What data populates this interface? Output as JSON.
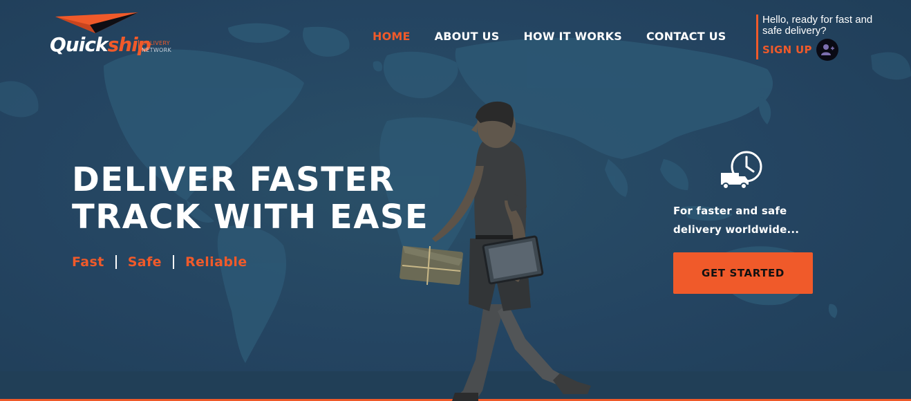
{
  "brand": {
    "name_part1": "Quick",
    "name_part2": "ship",
    "tagline_line1": "DELIVERY",
    "tagline_line2": "NETWORK"
  },
  "nav": {
    "items": [
      {
        "label": "HOME",
        "active": true
      },
      {
        "label": "ABOUT US",
        "active": false
      },
      {
        "label": "HOW IT WORKS",
        "active": false
      },
      {
        "label": "CONTACT US",
        "active": false
      }
    ]
  },
  "account": {
    "greeting": "Hello, ready for fast and safe delivery?",
    "signup_label": "SIGN UP",
    "signup_icon": "user-plus-icon"
  },
  "hero": {
    "headline_line1": "DELIVER FASTER",
    "headline_line2": "TRACK WITH EASE",
    "features": [
      "Fast",
      "Safe",
      "Reliable"
    ]
  },
  "cta": {
    "icon": "delivery-truck-clock-icon",
    "text": "For faster and safe delivery worldwide...",
    "button_label": "GET STARTED"
  },
  "colors": {
    "accent": "#f05a2a",
    "background": "#264660",
    "text": "#ffffff"
  }
}
